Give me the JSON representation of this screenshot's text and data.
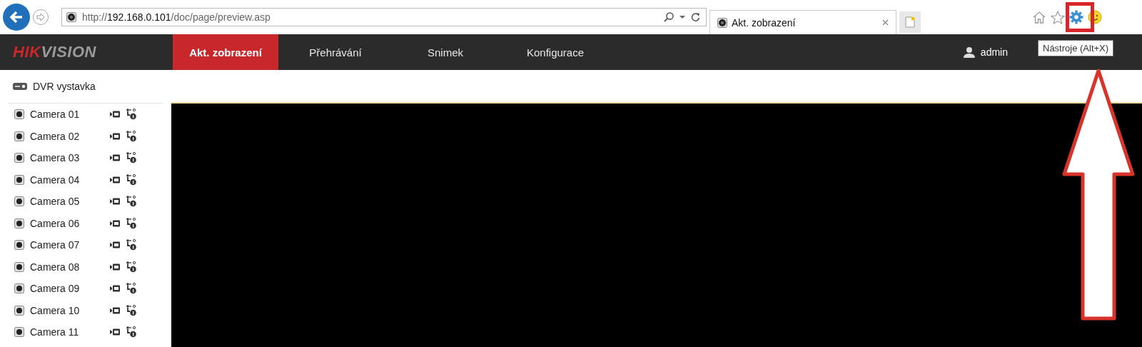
{
  "browser": {
    "url": {
      "scheme": "http://",
      "host": "192.168.0.101",
      "path": "/doc/page/preview.asp"
    },
    "tab": {
      "title": "Akt. zobrazení"
    },
    "tooltip": "Nástroje (Alt+X)"
  },
  "header": {
    "logo": {
      "accent": "HIK",
      "rest": "VISION"
    },
    "nav": [
      {
        "label": "Akt. zobrazení",
        "selected": true
      },
      {
        "label": "Přehrávání",
        "selected": false
      },
      {
        "label": "Snimek",
        "selected": false
      },
      {
        "label": "Konfigurace",
        "selected": false
      }
    ],
    "user": "admin"
  },
  "sidebar": {
    "device": "DVR vystavka",
    "cameras": [
      {
        "name": "Camera 01"
      },
      {
        "name": "Camera 02"
      },
      {
        "name": "Camera 03"
      },
      {
        "name": "Camera 04"
      },
      {
        "name": "Camera 05"
      },
      {
        "name": "Camera 06"
      },
      {
        "name": "Camera 07"
      },
      {
        "name": "Camera 08"
      },
      {
        "name": "Camera 09"
      },
      {
        "name": "Camera 10"
      },
      {
        "name": "Camera 11"
      }
    ]
  }
}
